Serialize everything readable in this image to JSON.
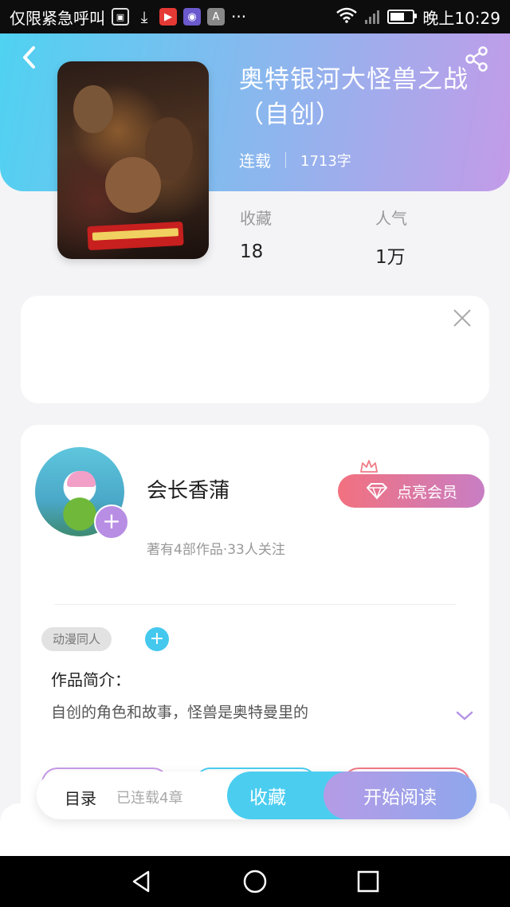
{
  "status_bar": {
    "left_text": "仅限紧急呼叫",
    "time": "晚上10:29",
    "icons": [
      "image-off-icon",
      "download-icon",
      "video-icon",
      "app-icon",
      "a-icon",
      "more-dots-icon",
      "wifi-icon",
      "signal-icon",
      "battery-icon"
    ],
    "more": "···",
    "a_label": "A",
    "battery_level": 0.55
  },
  "header": {
    "back_icon": "back-chevron-icon",
    "share_icon": "share-icon",
    "gradient": [
      "#4fd2f1",
      "#8fb5ee",
      "#c39be8"
    ]
  },
  "book": {
    "title": "奥特银河大怪兽之战（自创）",
    "status": "连载",
    "word_count": "1713字",
    "stats": [
      {
        "label": "收藏",
        "value": "18"
      },
      {
        "label": "人气",
        "value": "1万"
      }
    ]
  },
  "author": {
    "name": "会长香蒲",
    "stats": "著有4部作品·33人关注",
    "vip_label": "点亮会员",
    "follow_plus": "+"
  },
  "tags": {
    "items": [
      "动漫同人"
    ],
    "add_plus": "+"
  },
  "intro": {
    "title": "作品简介：",
    "text": "自创的角色和故事，怪兽是奥特曼里的"
  },
  "bottom_bar": {
    "toc_label": "目录",
    "toc_count": "已连载4章",
    "collect_label": "收藏",
    "read_label": "开始阅读",
    "accent": "#4bcdf0"
  }
}
